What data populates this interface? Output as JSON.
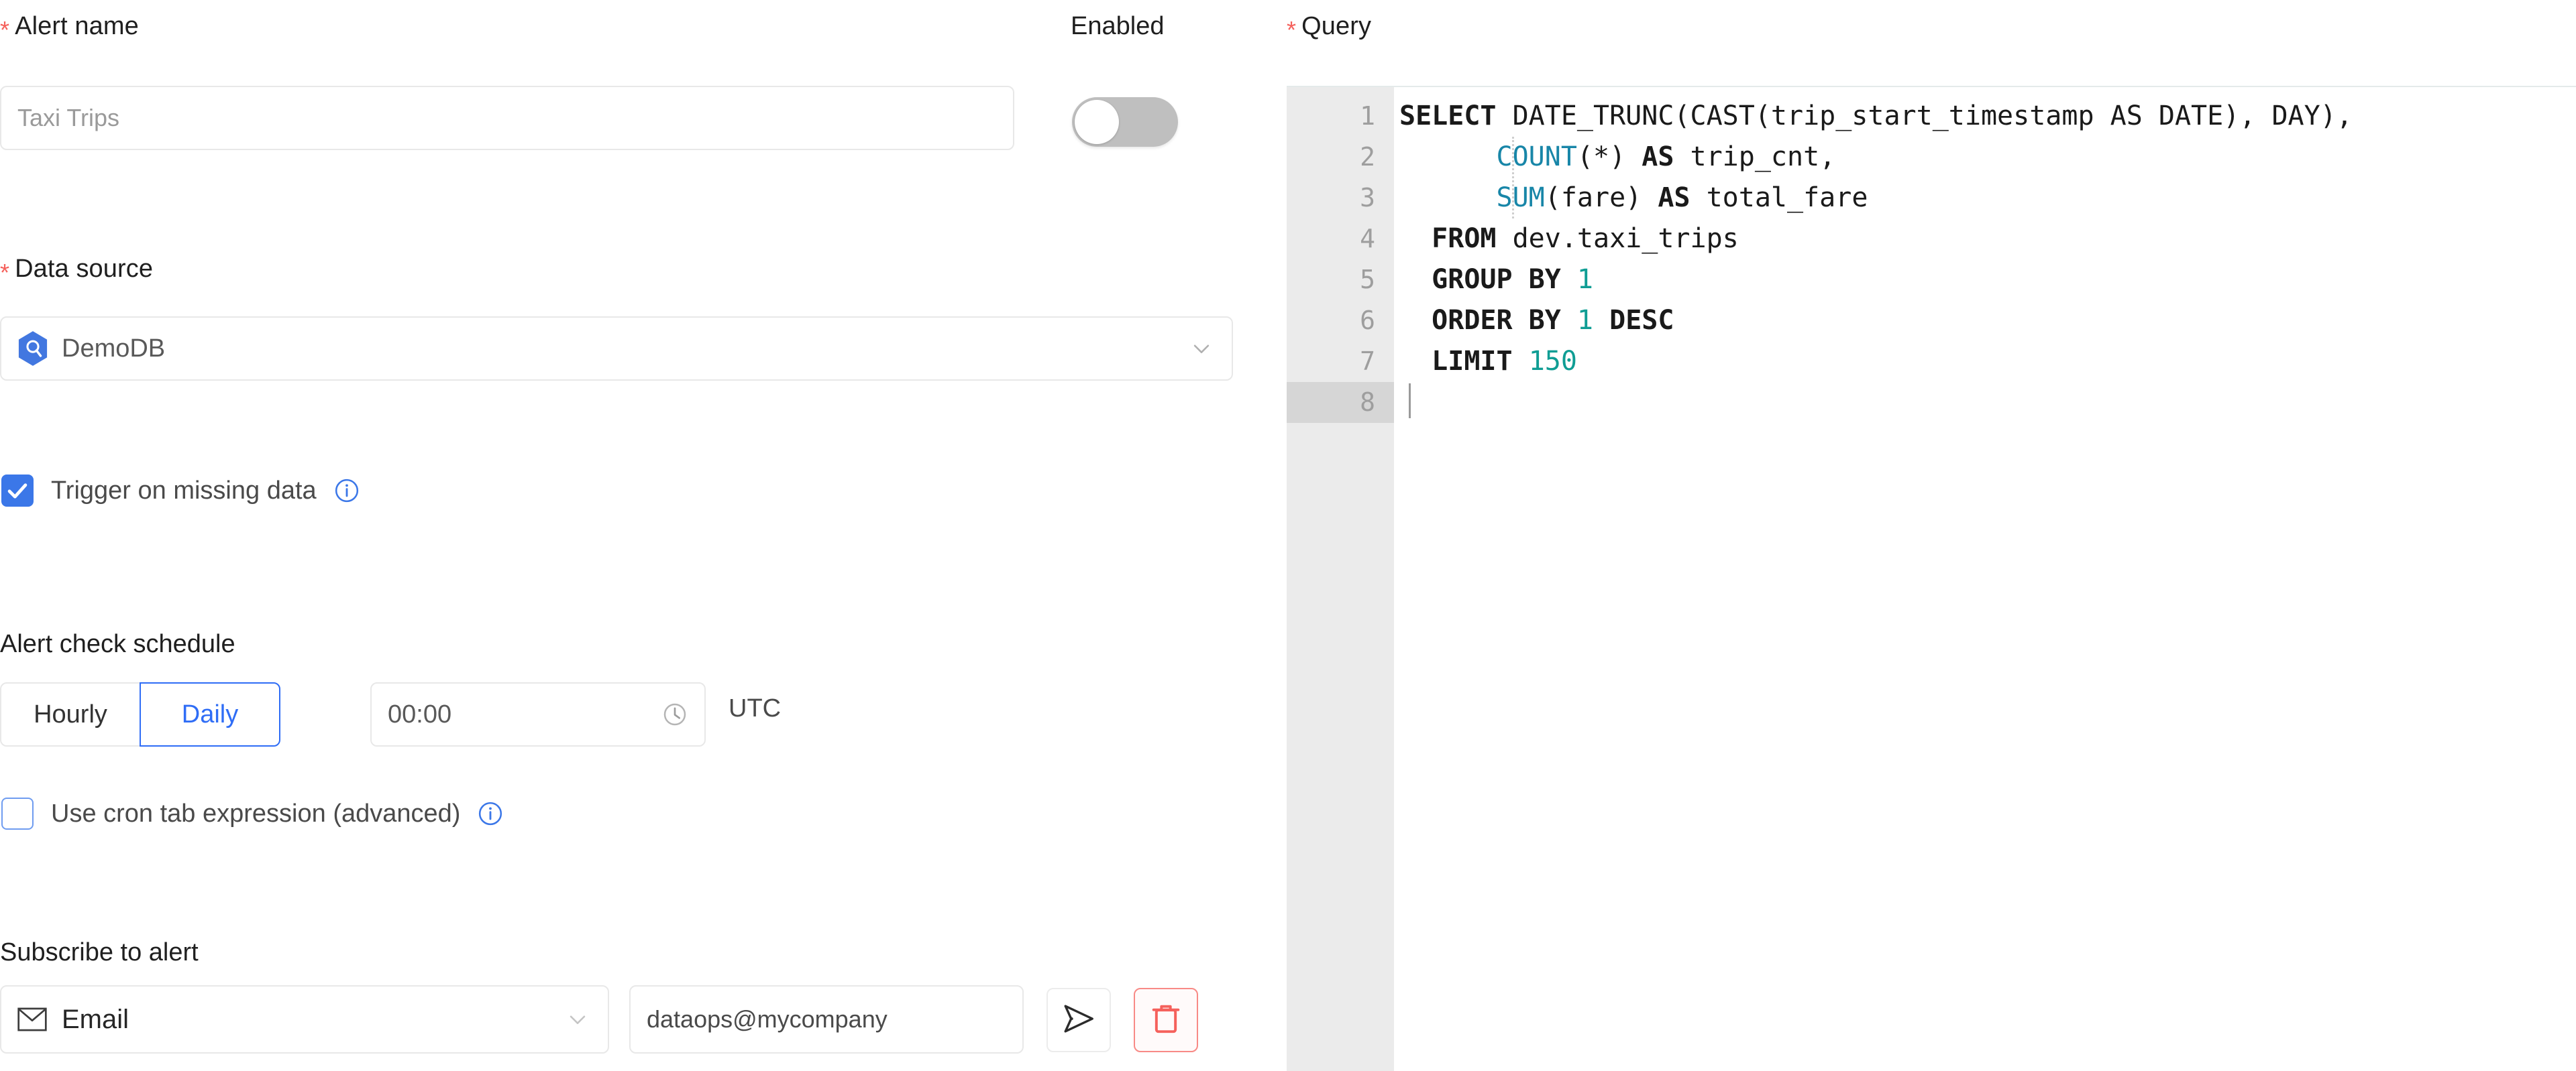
{
  "form": {
    "alert_name": {
      "label": "Alert name",
      "required_marker": "*",
      "placeholder": "Taxi Trips",
      "value": ""
    },
    "enabled": {
      "label": "Enabled",
      "state": "off"
    },
    "data_source": {
      "label": "Data source",
      "required_marker": "*",
      "selected": "DemoDB",
      "icon": "database-hex-icon",
      "chevron": "chevron-down-icon"
    },
    "trigger_missing_data": {
      "label": "Trigger on missing data",
      "checked": true,
      "info_icon": "info-circle-icon"
    },
    "schedule": {
      "heading": "Alert check schedule",
      "options": [
        "Hourly",
        "Daily"
      ],
      "selected": "Daily",
      "time_value": "00:00",
      "time_icon": "clock-icon",
      "timezone": "UTC"
    },
    "cron": {
      "label": "Use cron tab expression (advanced)",
      "checked": false,
      "info_icon": "info-circle-icon"
    },
    "subscribe": {
      "heading": "Subscribe to alert",
      "channel": "Email",
      "channel_icon": "envelope-icon",
      "channel_chevron": "chevron-down-icon",
      "recipient": "dataops@mycompany",
      "send_icon": "send-plane-icon",
      "delete_icon": "trash-icon"
    }
  },
  "query": {
    "label": "Query",
    "required_marker": "*",
    "active_line": 8,
    "line_numbers": [
      "1",
      "2",
      "3",
      "4",
      "5",
      "6",
      "7",
      "8"
    ],
    "sql_text": "SELECT DATE_TRUNC(CAST(trip_start_timestamp AS DATE), DAY),\n      COUNT(*) AS trip_cnt,\n      SUM(fare) AS total_fare\n  FROM dev.taxi_trips\n  GROUP BY 1\n  ORDER BY 1 DESC\n  LIMIT 150\n",
    "lines": [
      {
        "n": "1",
        "tokens": [
          {
            "t": "SELECT",
            "c": "kw"
          },
          {
            "t": " DATE_TRUNC(CAST(trip_start_timestamp AS DATE), DAY),",
            "c": "plain"
          }
        ]
      },
      {
        "n": "2",
        "tokens": [
          {
            "t": "      ",
            "c": "plain"
          },
          {
            "t": "COUNT",
            "c": "fn"
          },
          {
            "t": "(*) ",
            "c": "plain"
          },
          {
            "t": "AS",
            "c": "kw"
          },
          {
            "t": " trip_cnt,",
            "c": "plain"
          }
        ]
      },
      {
        "n": "3",
        "tokens": [
          {
            "t": "      ",
            "c": "plain"
          },
          {
            "t": "SUM",
            "c": "fn"
          },
          {
            "t": "(fare) ",
            "c": "plain"
          },
          {
            "t": "AS",
            "c": "kw"
          },
          {
            "t": " total_fare",
            "c": "plain"
          }
        ]
      },
      {
        "n": "4",
        "tokens": [
          {
            "t": "  ",
            "c": "plain"
          },
          {
            "t": "FROM",
            "c": "kw"
          },
          {
            "t": " dev.taxi_trips",
            "c": "plain"
          }
        ]
      },
      {
        "n": "5",
        "tokens": [
          {
            "t": "  ",
            "c": "plain"
          },
          {
            "t": "GROUP BY",
            "c": "kw"
          },
          {
            "t": " ",
            "c": "plain"
          },
          {
            "t": "1",
            "c": "num"
          }
        ]
      },
      {
        "n": "6",
        "tokens": [
          {
            "t": "  ",
            "c": "plain"
          },
          {
            "t": "ORDER BY",
            "c": "kw"
          },
          {
            "t": " ",
            "c": "plain"
          },
          {
            "t": "1",
            "c": "num"
          },
          {
            "t": " ",
            "c": "plain"
          },
          {
            "t": "DESC",
            "c": "kw"
          }
        ]
      },
      {
        "n": "7",
        "tokens": [
          {
            "t": "  ",
            "c": "plain"
          },
          {
            "t": "LIMIT",
            "c": "kw"
          },
          {
            "t": " ",
            "c": "plain"
          },
          {
            "t": "150",
            "c": "num"
          }
        ]
      },
      {
        "n": "8",
        "tokens": []
      }
    ]
  },
  "colors": {
    "required_star": "#f5615c",
    "accent_blue": "#2f6df6",
    "checkbox_blue": "#3b77e8",
    "danger_red": "#f5615c",
    "sql_function": "#1886a8",
    "sql_number": "#0f9d94",
    "gutter_bg": "#ebebeb",
    "toggle_off_bg": "#bfbfbf"
  }
}
